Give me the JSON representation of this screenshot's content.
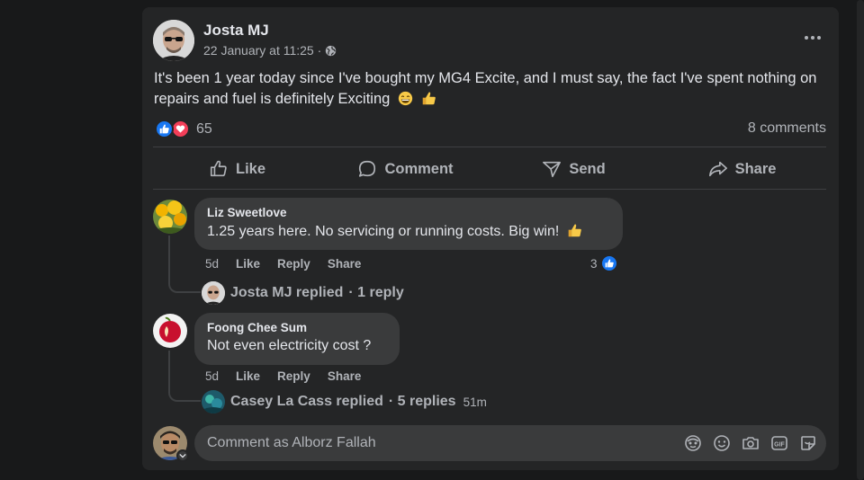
{
  "post": {
    "author": "Josta MJ",
    "time": "22 January at 11:25 ·",
    "audience_icon": "globe-icon",
    "text": "It's been 1 year today since I've bought my MG4 Excite, and I must say, the fact I've spent nothing on repairs and fuel is definitely Exciting",
    "text_emojis": [
      "grinning-face-emoji",
      "thumbs-up-emoji"
    ],
    "reaction_types": [
      "like",
      "love"
    ],
    "reaction_count": "65",
    "comments_count": "8 comments"
  },
  "actions": {
    "like": "Like",
    "comment": "Comment",
    "send": "Send",
    "share": "Share"
  },
  "comments": [
    {
      "author": "Liz Sweetlove",
      "text": "1.25 years here. No servicing or running costs. Big win!",
      "time": "5d",
      "like": "Like",
      "reply": "Reply",
      "share": "Share",
      "likes": "3",
      "reply_author": "Josta MJ replied",
      "reply_count": "· 1 reply",
      "reply_time": ""
    },
    {
      "author": "Foong Chee Sum",
      "text": "Not even electricity cost ?",
      "time": "5d",
      "like": "Like",
      "reply": "Reply",
      "share": "Share",
      "reply_author": "Casey La Cass replied",
      "reply_count": "· 5 replies",
      "reply_time": "51m"
    }
  ],
  "composer": {
    "placeholder": "Comment as Alborz Fallah",
    "icons": [
      "avatar-sticker-icon",
      "emoji-icon",
      "camera-icon",
      "gif-icon",
      "sticker-icon"
    ]
  },
  "colors": {
    "background": "#18191a",
    "card": "#242526",
    "bubble": "#3a3b3c",
    "primary_text": "#e4e6eb",
    "secondary_text": "#b0b3b8",
    "like_blue": "#1877f2",
    "love_red": "#f33e58"
  }
}
